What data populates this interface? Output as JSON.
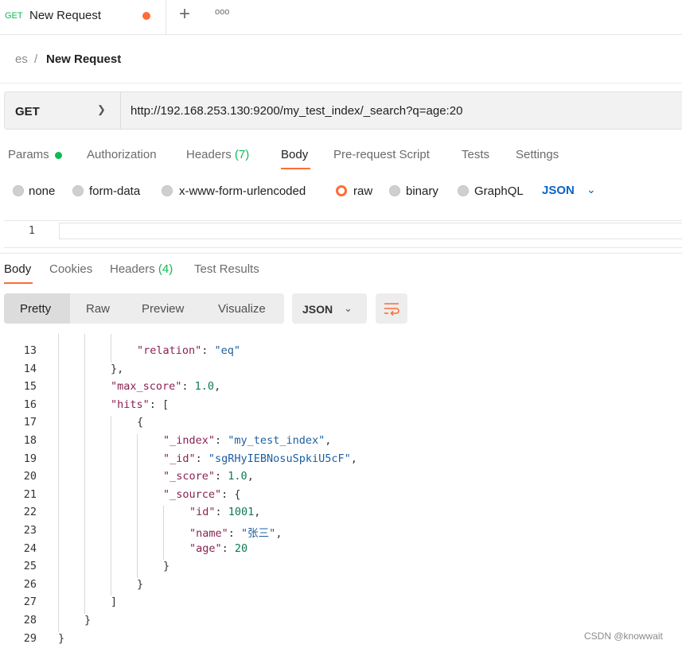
{
  "tab": {
    "method": "GET",
    "title": "New Request",
    "new_tab_symbol": "+",
    "more_symbol": "ooo"
  },
  "breadcrumb": {
    "parent": "es",
    "separator": "/",
    "title": "New Request"
  },
  "request": {
    "method": "GET",
    "url": "http://192.168.253.130:9200/my_test_index/_search?q=age:20"
  },
  "request_tabs": [
    {
      "label": "Params"
    },
    {
      "label": "Authorization"
    },
    {
      "label": "Headers",
      "count": "(7)"
    },
    {
      "label": "Body"
    },
    {
      "label": "Pre-request Script"
    },
    {
      "label": "Tests"
    },
    {
      "label": "Settings"
    }
  ],
  "body_types": [
    "none",
    "form-data",
    "x-www-form-urlencoded",
    "raw",
    "binary",
    "GraphQL"
  ],
  "body_selected": "raw",
  "body_language": "JSON",
  "request_editor": {
    "line": "1"
  },
  "response_tabs": [
    {
      "label": "Body"
    },
    {
      "label": "Cookies"
    },
    {
      "label": "Headers",
      "count": "(4)"
    },
    {
      "label": "Test Results"
    }
  ],
  "view_modes": [
    "Pretty",
    "Raw",
    "Preview",
    "Visualize"
  ],
  "response_format": "JSON",
  "code_lines": [
    {
      "n": "13",
      "indent": 3,
      "parts": [
        [
          "k",
          "\"relation\""
        ],
        [
          "p",
          ": "
        ],
        [
          "s",
          "\"eq\""
        ]
      ]
    },
    {
      "n": "14",
      "indent": 2,
      "parts": [
        [
          "p",
          "},"
        ]
      ]
    },
    {
      "n": "15",
      "indent": 2,
      "parts": [
        [
          "k",
          "\"max_score\""
        ],
        [
          "p",
          ": "
        ],
        [
          "n",
          "1.0"
        ],
        [
          "p",
          ","
        ]
      ]
    },
    {
      "n": "16",
      "indent": 2,
      "parts": [
        [
          "k",
          "\"hits\""
        ],
        [
          "p",
          ": ["
        ]
      ]
    },
    {
      "n": "17",
      "indent": 3,
      "parts": [
        [
          "p",
          "{"
        ]
      ]
    },
    {
      "n": "18",
      "indent": 4,
      "parts": [
        [
          "k",
          "\"_index\""
        ],
        [
          "p",
          ": "
        ],
        [
          "s",
          "\"my_test_index\""
        ],
        [
          "p",
          ","
        ]
      ]
    },
    {
      "n": "19",
      "indent": 4,
      "parts": [
        [
          "k",
          "\"_id\""
        ],
        [
          "p",
          ": "
        ],
        [
          "s",
          "\"sgRHyIEBNosuSpkiU5cF\""
        ],
        [
          "p",
          ","
        ]
      ]
    },
    {
      "n": "20",
      "indent": 4,
      "parts": [
        [
          "k",
          "\"_score\""
        ],
        [
          "p",
          ": "
        ],
        [
          "n",
          "1.0"
        ],
        [
          "p",
          ","
        ]
      ]
    },
    {
      "n": "21",
      "indent": 4,
      "parts": [
        [
          "k",
          "\"_source\""
        ],
        [
          "p",
          ": {"
        ]
      ]
    },
    {
      "n": "22",
      "indent": 5,
      "parts": [
        [
          "k",
          "\"id\""
        ],
        [
          "p",
          ": "
        ],
        [
          "n",
          "1001"
        ],
        [
          "p",
          ","
        ]
      ]
    },
    {
      "n": "23",
      "indent": 5,
      "parts": [
        [
          "k",
          "\"name\""
        ],
        [
          "p",
          ": "
        ],
        [
          "s",
          "\"张三\""
        ],
        [
          "p",
          ","
        ]
      ]
    },
    {
      "n": "24",
      "indent": 5,
      "parts": [
        [
          "k",
          "\"age\""
        ],
        [
          "p",
          ": "
        ],
        [
          "n",
          "20"
        ]
      ]
    },
    {
      "n": "25",
      "indent": 4,
      "parts": [
        [
          "p",
          "}"
        ]
      ]
    },
    {
      "n": "26",
      "indent": 3,
      "parts": [
        [
          "p",
          "}"
        ]
      ]
    },
    {
      "n": "27",
      "indent": 2,
      "parts": [
        [
          "p",
          "]"
        ]
      ]
    },
    {
      "n": "28",
      "indent": 1,
      "parts": [
        [
          "p",
          "}"
        ]
      ]
    },
    {
      "n": "29",
      "indent": 0,
      "parts": [
        [
          "p",
          "}"
        ]
      ]
    }
  ],
  "watermark": "CSDN @knowwait",
  "colors": {
    "accent": "#ff6c37",
    "method_get": "#0cbb52",
    "json_blue": "#0b63c6"
  }
}
